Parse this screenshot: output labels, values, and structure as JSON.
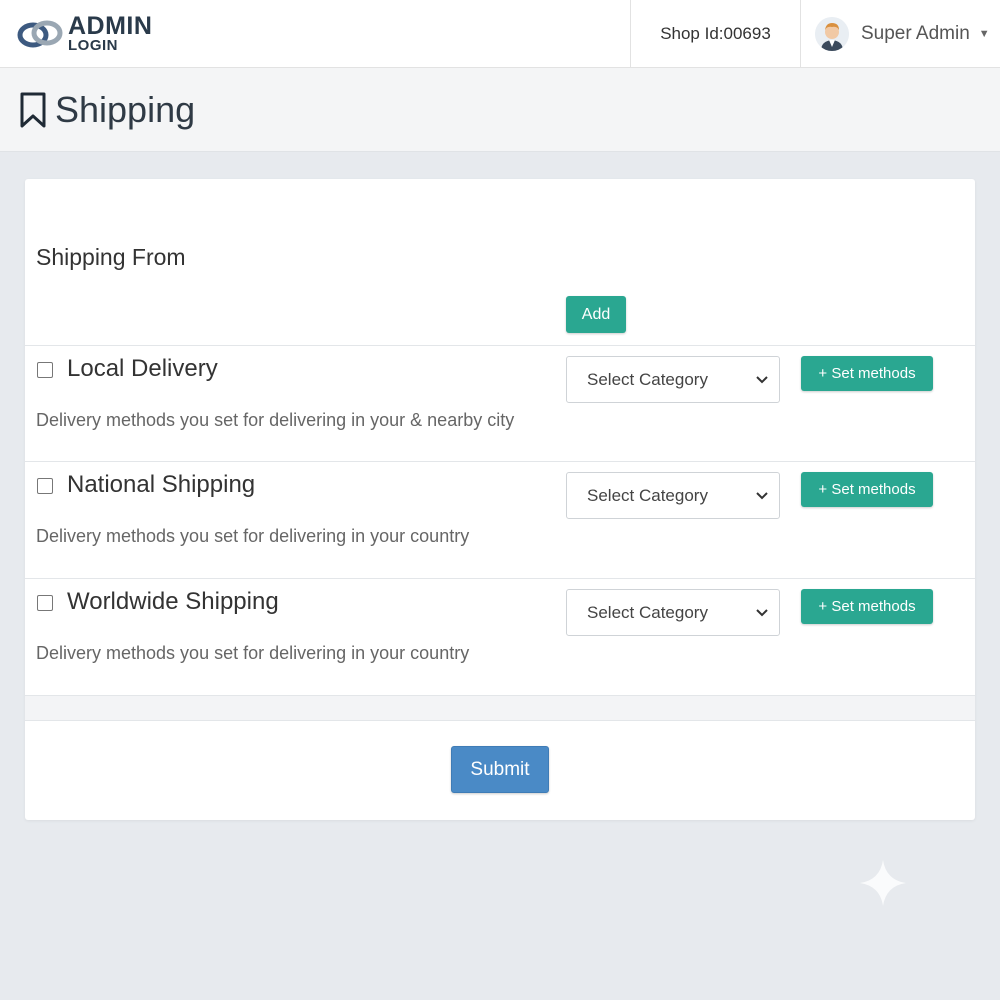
{
  "header": {
    "logo_title": "ADMIN",
    "logo_sub": "LOGIN",
    "shop_id": "Shop Id:00693",
    "user_name": "Super Admin",
    "icons": [
      "logo-icon",
      "avatar-icon",
      "caret-down-icon"
    ]
  },
  "page": {
    "title": "Shipping",
    "title_icon": "bookmark-icon"
  },
  "form": {
    "from_label": "Shipping From",
    "add_label": "Add",
    "rows": [
      {
        "title": "Local Delivery",
        "checked": false,
        "description": "Delivery methods you set for delivering in your & nearby city",
        "select_value": "Select Category",
        "set_label": "+ Set methods"
      },
      {
        "title": "National Shipping",
        "checked": false,
        "description": "Delivery methods you set for delivering in your country",
        "select_value": "Select Category",
        "set_label": "+ Set methods"
      },
      {
        "title": "Worldwide Shipping",
        "checked": false,
        "description": "Delivery methods you set for delivering in your country",
        "select_value": "Select Category",
        "set_label": "+ Set methods"
      }
    ],
    "submit_label": "Submit"
  },
  "colors": {
    "accent_green": "#2aa791",
    "submit_blue": "#4a8ac6",
    "background": "#e7eaee"
  }
}
